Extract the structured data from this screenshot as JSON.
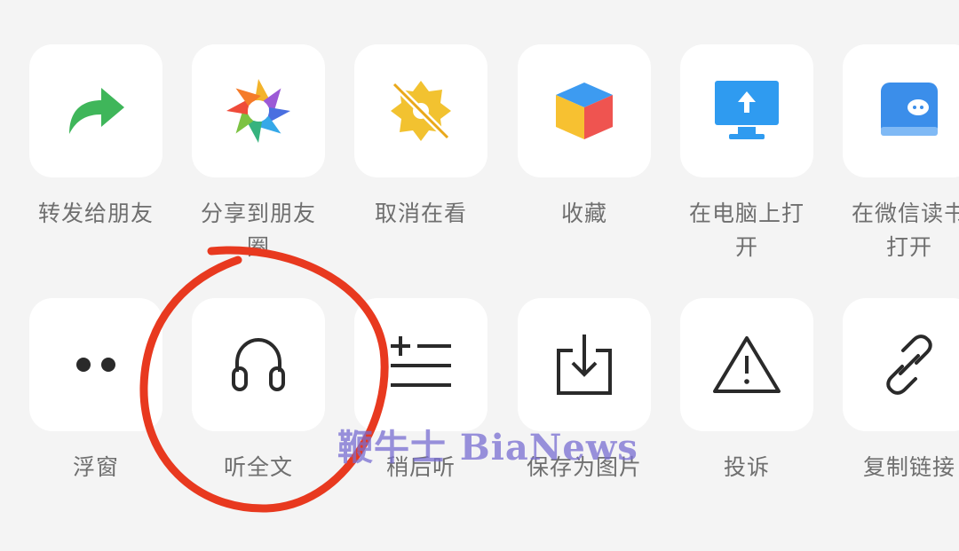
{
  "share_sheet": {
    "row1": [
      {
        "label": "转发给朋友",
        "icon": "forward-arrow-icon"
      },
      {
        "label": "分享到朋友圈",
        "icon": "moments-aperture-icon"
      },
      {
        "label": "取消在看",
        "icon": "unwow-star-icon"
      },
      {
        "label": "收藏",
        "icon": "favorite-cube-icon"
      },
      {
        "label": "在电脑上打开",
        "icon": "computer-monitor-icon"
      },
      {
        "label": "在微信读书打开",
        "icon": "weread-book-icon"
      }
    ],
    "row2": [
      {
        "label": "浮窗",
        "icon": "floating-window-dots-icon"
      },
      {
        "label": "听全文",
        "icon": "headphones-icon"
      },
      {
        "label": "稍后听",
        "icon": "listen-later-list-icon"
      },
      {
        "label": "保存为图片",
        "icon": "save-image-download-icon"
      },
      {
        "label": "投诉",
        "icon": "warning-triangle-icon"
      },
      {
        "label": "复制链接",
        "icon": "link-chain-icon"
      }
    ]
  },
  "annotation": {
    "color": "#e8391f",
    "target": "听全文"
  },
  "watermark": {
    "text": "鞭牛士 BiaNews"
  },
  "colors": {
    "background": "#f4f4f4",
    "tile": "#ffffff",
    "label": "#6f6f6f",
    "forward_green": "#3fb65a",
    "monitor_blue": "#2f9bf0"
  }
}
